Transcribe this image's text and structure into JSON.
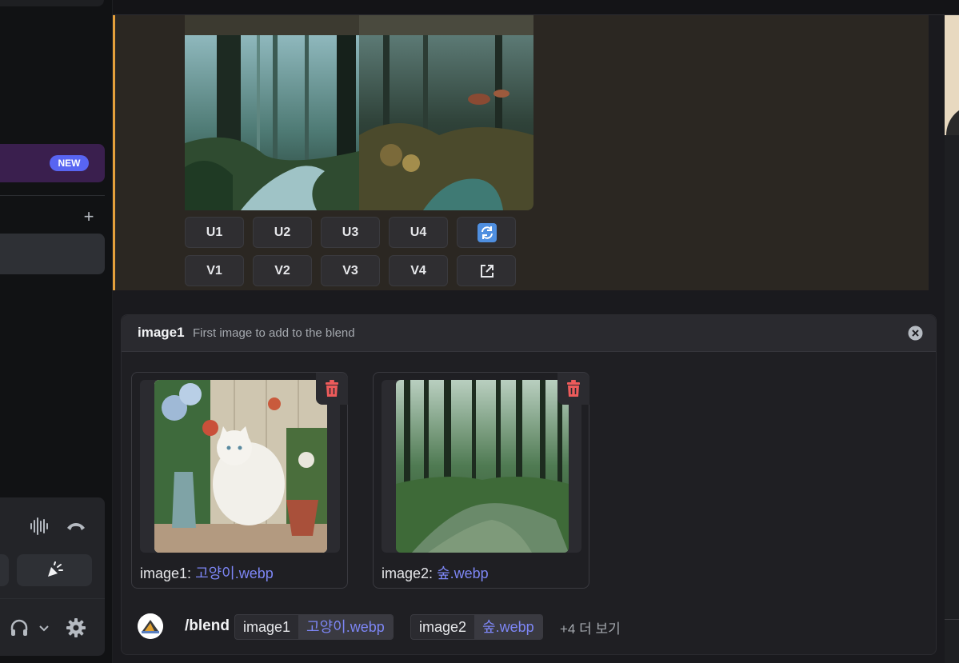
{
  "sidebar": {
    "new_badge": "NEW",
    "add_icon": "+"
  },
  "voice_panel": {
    "icons": [
      "soundwave-icon",
      "hang-up-icon",
      "soundboard-icon",
      "headphones-icon",
      "chevron-down-icon",
      "gear-icon"
    ]
  },
  "message": {
    "upscale_buttons": [
      "U1",
      "U2",
      "U3",
      "U4"
    ],
    "variation_buttons": [
      "V1",
      "V2",
      "V3",
      "V4"
    ],
    "reroll_icon": "refresh-icon",
    "open_icon": "external-link-icon"
  },
  "command_panel": {
    "option_name": "image1",
    "option_description": "First image to add to the blend",
    "attachments": [
      {
        "label_prefix": "image1:",
        "filename": "고양이.webp"
      },
      {
        "label_prefix": "image2:",
        "filename": "숲.webp"
      }
    ],
    "command": "/blend",
    "params": [
      {
        "key": "image1",
        "value": "고양이.webp"
      },
      {
        "key": "image2",
        "value": "숲.webp"
      }
    ],
    "more_text": "+4 더 보기"
  },
  "colors": {
    "accent_bar": "#e5a03b",
    "new_badge": "#5865f2",
    "link": "#7d86f5",
    "trash": "#ed5b5b"
  }
}
